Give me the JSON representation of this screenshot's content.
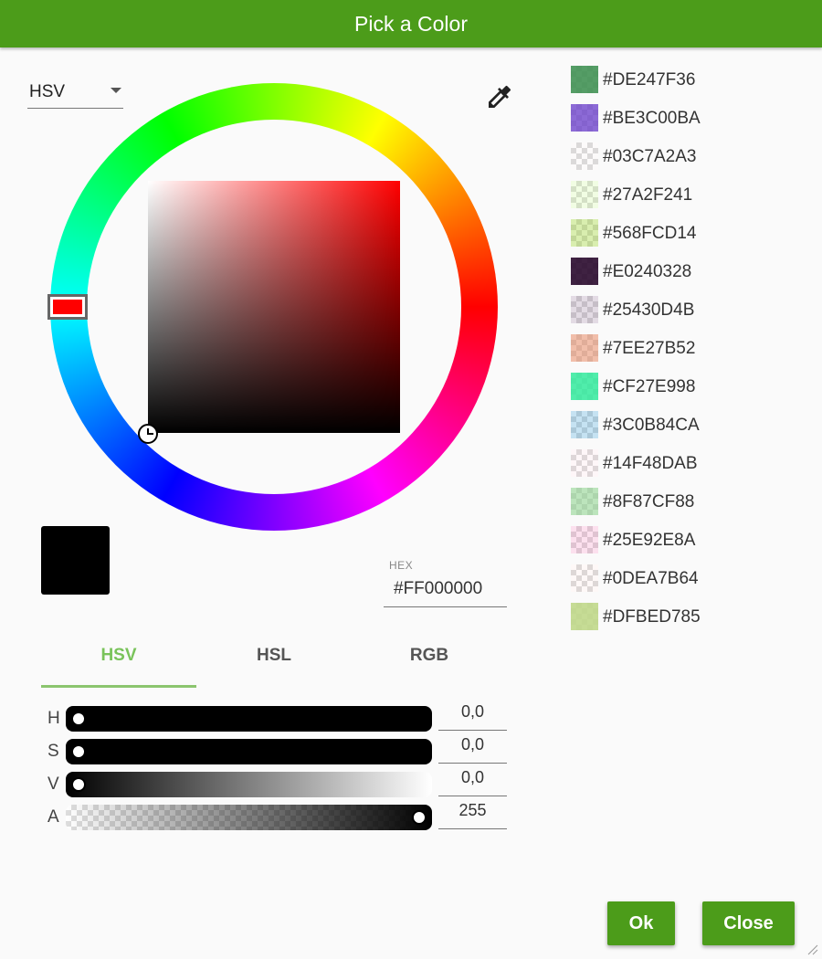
{
  "dialog": {
    "title": "Pick a Color"
  },
  "mode_select": {
    "value": "HSV"
  },
  "current_color": {
    "hex_label": "HEX",
    "hex_value": "#FF000000",
    "preview": "#000000",
    "hue_color": "#FF0000"
  },
  "tabs": [
    {
      "label": "HSV",
      "active": true
    },
    {
      "label": "HSL",
      "active": false
    },
    {
      "label": "RGB",
      "active": false
    }
  ],
  "sliders": [
    {
      "label": "H",
      "value": "0,0"
    },
    {
      "label": "S",
      "value": "0,0"
    },
    {
      "label": "V",
      "value": "0,0"
    },
    {
      "label": "A",
      "value": "255"
    }
  ],
  "swatches": [
    {
      "code": "#DE247F36",
      "color": "#3C8E4F",
      "alpha": 0.87
    },
    {
      "code": "#BE3C00BA",
      "color": "#6638C8",
      "alpha": 0.75
    },
    {
      "code": "#03C7A2A3",
      "color": "#C7A2A3",
      "alpha": 0.05
    },
    {
      "code": "#27A2F241",
      "color": "#A2F241",
      "alpha": 0.15
    },
    {
      "code": "#568FCD14",
      "color": "#8FCD14",
      "alpha": 0.34
    },
    {
      "code": "#E0240328",
      "color": "#240328",
      "alpha": 0.88
    },
    {
      "code": "#25430D4B",
      "color": "#430D4B",
      "alpha": 0.15
    },
    {
      "code": "#7EE27B52",
      "color": "#E27B52",
      "alpha": 0.49
    },
    {
      "code": "#CF27E998",
      "color": "#27E998",
      "alpha": 0.81
    },
    {
      "code": "#3C0B84CA",
      "color": "#0B84CA",
      "alpha": 0.24
    },
    {
      "code": "#14F48DAB",
      "color": "#F48DAB",
      "alpha": 0.08
    },
    {
      "code": "#8F87CF88",
      "color": "#87CF88",
      "alpha": 0.56
    },
    {
      "code": "#25E92E8A",
      "color": "#E92E8A",
      "alpha": 0.15
    },
    {
      "code": "#0DEA7B64",
      "color": "#EA7B64",
      "alpha": 0.05
    },
    {
      "code": "#DFBED785",
      "color": "#BED785",
      "alpha": 0.87
    }
  ],
  "buttons": {
    "ok": "Ok",
    "close": "Close"
  },
  "colors": {
    "accent": "#4C9C1A",
    "tab_active": "#79C35A"
  },
  "icons": {
    "eyedropper": "eyedropper-icon",
    "dropdown": "chevron-down-icon",
    "resize": "resize-grip-icon"
  }
}
